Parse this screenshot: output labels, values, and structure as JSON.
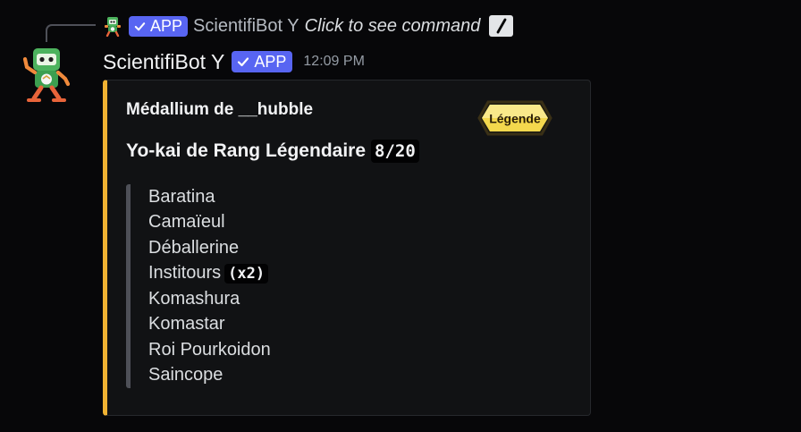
{
  "reply": {
    "app_tag": "APP",
    "bot_name": "ScientifiBot Y",
    "command_hint": "Click to see command"
  },
  "message": {
    "username": "ScientifiBot Y",
    "app_tag": "APP",
    "timestamp": "12:09 PM"
  },
  "embed": {
    "accent_color": "#f0b232",
    "author": "Médallium de __hubble",
    "title": "Yo-kai de Rang Légendaire",
    "count": "8/20",
    "thumbnail_label": "Légende",
    "items": [
      {
        "name": "Baratina",
        "badge": ""
      },
      {
        "name": "Camaïeul",
        "badge": ""
      },
      {
        "name": "Déballerine",
        "badge": ""
      },
      {
        "name": "Institours",
        "badge": "(x2)"
      },
      {
        "name": "Komashura",
        "badge": ""
      },
      {
        "name": "Komastar",
        "badge": ""
      },
      {
        "name": "Roi Pourkoidon",
        "badge": ""
      },
      {
        "name": "Saincope",
        "badge": ""
      }
    ]
  },
  "icons": {
    "avatar": "robot-avatar-icon",
    "check": "check-icon",
    "slash": "slash-command-icon"
  },
  "colors": {
    "app_tag": "#5865f2",
    "background": "#070709",
    "embed_bg": "#111214"
  }
}
